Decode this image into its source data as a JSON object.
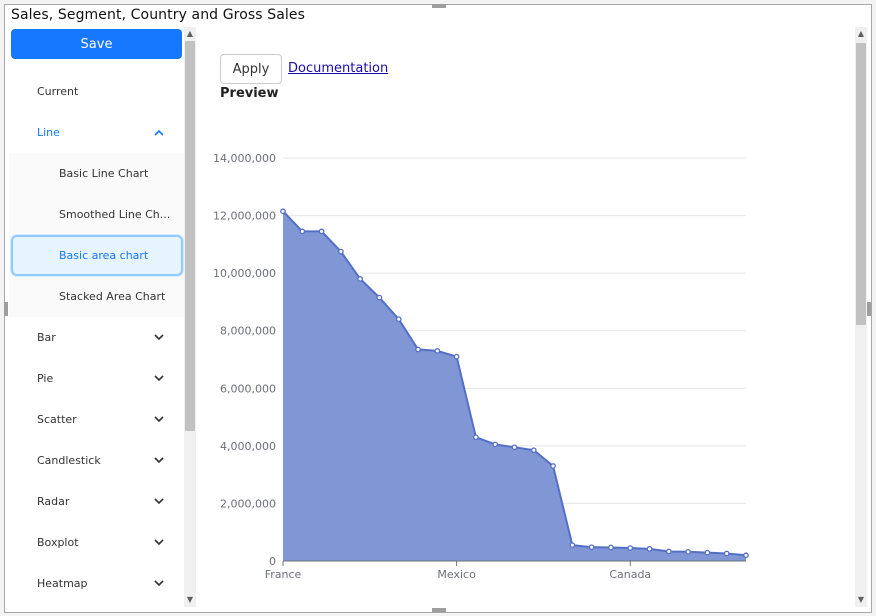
{
  "window": {
    "title": "Sales, Segment, Country and Gross Sales"
  },
  "sidebar": {
    "save_label": "Save",
    "items": [
      {
        "label": "Current"
      },
      {
        "label": "Line",
        "expanded": true
      },
      {
        "label": "Basic Line Chart"
      },
      {
        "label": "Smoothed Line Ch..."
      },
      {
        "label": "Basic area chart",
        "selected": true
      },
      {
        "label": "Stacked Area Chart"
      },
      {
        "label": "Bar"
      },
      {
        "label": "Pie"
      },
      {
        "label": "Scatter"
      },
      {
        "label": "Candlestick"
      },
      {
        "label": "Radar"
      },
      {
        "label": "Boxplot"
      },
      {
        "label": "Heatmap"
      }
    ]
  },
  "main": {
    "apply_label": "Apply",
    "doc_label": "Documentation",
    "preview_label": "Preview"
  },
  "colors": {
    "accent": "#1677ff",
    "series": "#5470c6",
    "area": "#8096d5"
  },
  "chart_data": {
    "type": "area",
    "x_tick_labels": [
      "France",
      "Mexico",
      "Canada"
    ],
    "y_tick_labels": [
      "0",
      "2,000,000",
      "4,000,000",
      "6,000,000",
      "8,000,000",
      "10,000,000",
      "12,000,000",
      "14,000,000"
    ],
    "ylim": [
      0,
      14000000
    ],
    "x": [
      0,
      1,
      2,
      3,
      4,
      5,
      6,
      7,
      8,
      9,
      10,
      11,
      12,
      13,
      14,
      15,
      16,
      17,
      18,
      19,
      20,
      21,
      22,
      23,
      24
    ],
    "values": [
      12150000,
      11450000,
      11450000,
      10750000,
      9800000,
      9150000,
      8400000,
      7350000,
      7300000,
      7100000,
      4300000,
      4050000,
      3950000,
      3850000,
      3300000,
      550000,
      480000,
      470000,
      450000,
      420000,
      330000,
      320000,
      290000,
      260000,
      200000
    ],
    "x_tick_positions": [
      0,
      9,
      18
    ]
  }
}
